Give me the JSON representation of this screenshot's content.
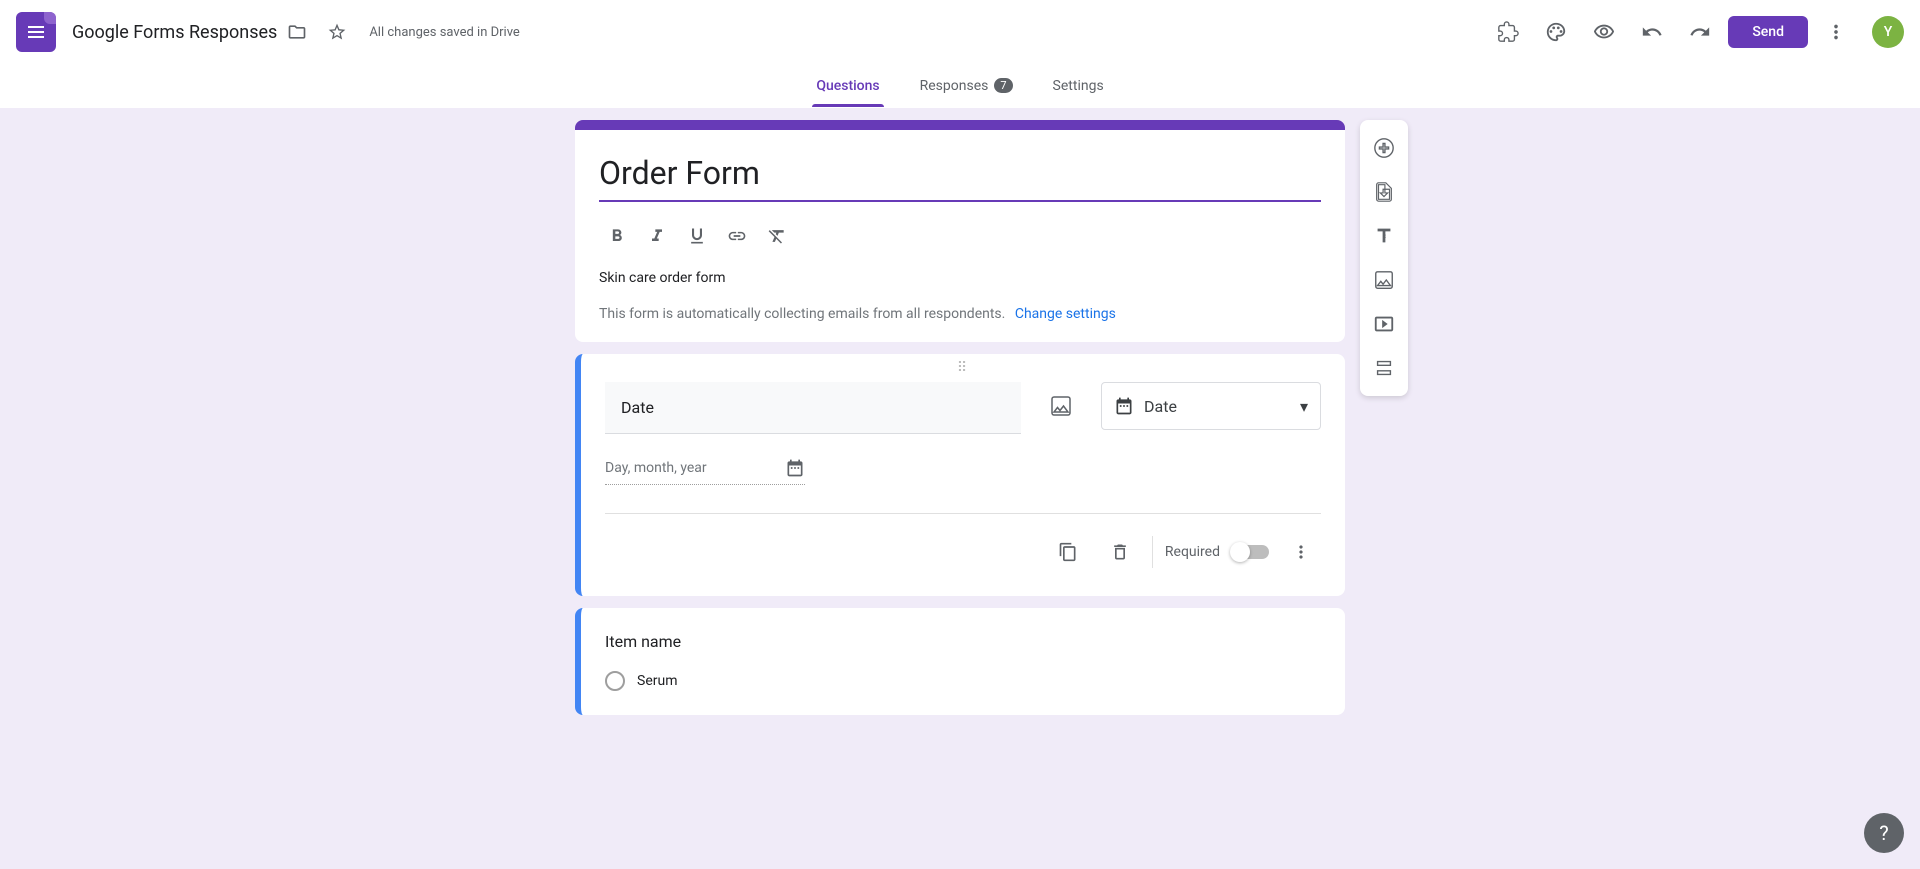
{
  "header": {
    "doc_title": "Google Forms Responses",
    "save_status": "All changes saved in Drive",
    "send_label": "Send",
    "avatar_letter": "Y"
  },
  "tabs": {
    "questions": "Questions",
    "responses": "Responses",
    "responses_count": "7",
    "settings": "Settings"
  },
  "title_card": {
    "form_title": "Order Form",
    "form_description": "Skin care order form",
    "collect_note": "This form is automatically collecting emails from all respondents.",
    "change_link": "Change settings"
  },
  "question1": {
    "title": "Date",
    "type_label": "Date",
    "date_placeholder": "Day, month, year",
    "required_label": "Required"
  },
  "question2": {
    "title": "Item name",
    "options": [
      "Serum"
    ]
  }
}
